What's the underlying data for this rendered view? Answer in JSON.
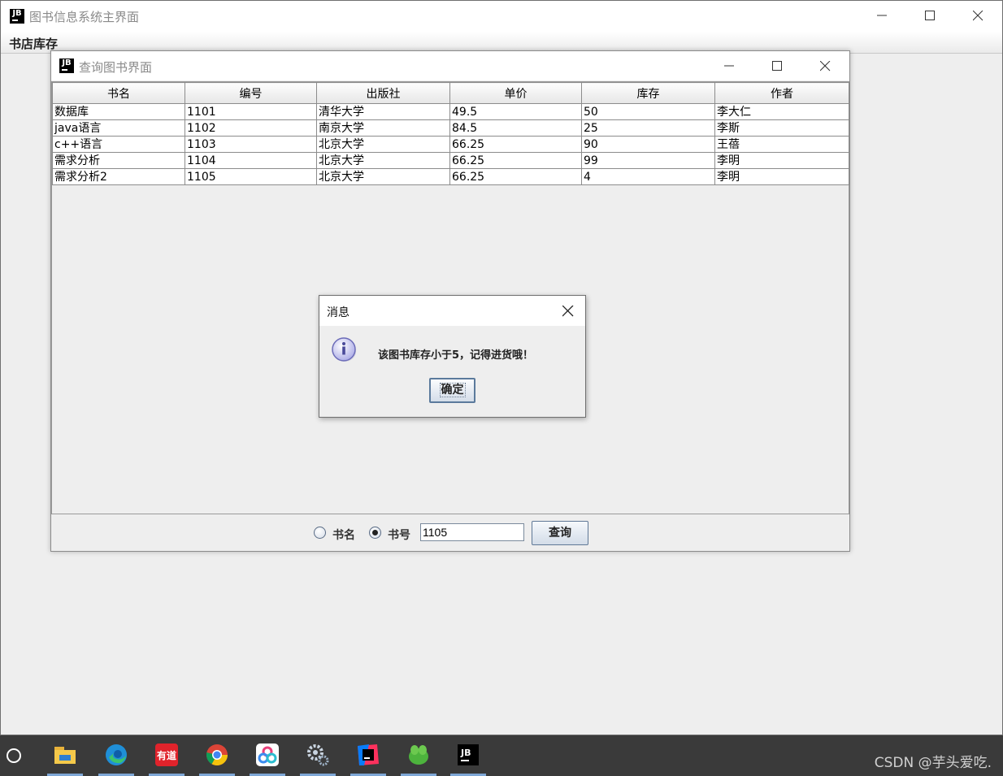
{
  "main_window": {
    "title": "图书信息系统主界面",
    "menu": [
      "书店库存"
    ]
  },
  "query_window": {
    "title": "查询图书界面",
    "table": {
      "columns": [
        "书名",
        "编号",
        "出版社",
        "单价",
        "库存",
        "作者"
      ],
      "rows": [
        [
          "数据库",
          "1101",
          "清华大学",
          "49.5",
          "50",
          "李大仁"
        ],
        [
          "java语言",
          "1102",
          "南京大学",
          "84.5",
          "25",
          "李斯"
        ],
        [
          "c++语言",
          "1103",
          "北京大学",
          "66.25",
          "90",
          "王蓓"
        ],
        [
          "需求分析",
          "1104",
          "北京大学",
          "66.25",
          "99",
          "李明"
        ],
        [
          "需求分析2",
          "1105",
          "北京大学",
          "66.25",
          "4",
          "李明"
        ]
      ]
    },
    "search": {
      "option_name": "书名",
      "option_id": "书号",
      "selected": "书号",
      "input_value": "1105",
      "button_label": "查询"
    }
  },
  "dialog": {
    "title": "消息",
    "message": "该图书库存小于5，记得进货哦！",
    "ok_label": "确定",
    "icon": "info-icon"
  },
  "taskbar": {
    "apps": [
      "file-explorer-icon",
      "edge-icon",
      "youdao-icon",
      "chrome-icon",
      "baidu-netdisk-icon",
      "settings-icon",
      "intellij-icon",
      "app-icon",
      "jb-java-icon"
    ],
    "youdao_label": "有道",
    "watermark": "CSDN @芋头爱吃."
  },
  "colors": {
    "title_inactive": "#8a8a8a",
    "background": "#eeeeee",
    "taskbar": "#3a3a3a",
    "accent_border": "#5b7a9c"
  }
}
